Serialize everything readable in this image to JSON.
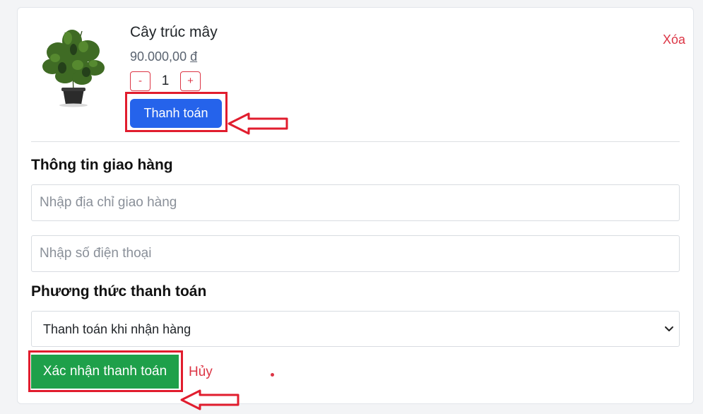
{
  "product": {
    "name": "Cây trúc mây",
    "price": "90.000,00",
    "currency": "đ",
    "quantity": "1",
    "decrement_label": "-",
    "increment_label": "+",
    "remove_label": "Xóa",
    "pay_label": "Thanh toán",
    "image_icon": "potted-plant-icon"
  },
  "shipping": {
    "title": "Thông tin giao hàng",
    "address_placeholder": "Nhập địa chỉ giao hàng",
    "phone_placeholder": "Nhập số điện thoại"
  },
  "payment": {
    "title": "Phương thức thanh toán",
    "selected_method": "Thanh toán khi nhận hàng",
    "dropdown_icon": "chevron-down-icon"
  },
  "actions": {
    "confirm_label": "Xác nhận thanh toán",
    "cancel_label": "Hủy"
  },
  "colors": {
    "danger": "#dc3545",
    "primary": "#2563eb",
    "success": "#1ea04a",
    "highlight": "#e11d2e"
  }
}
